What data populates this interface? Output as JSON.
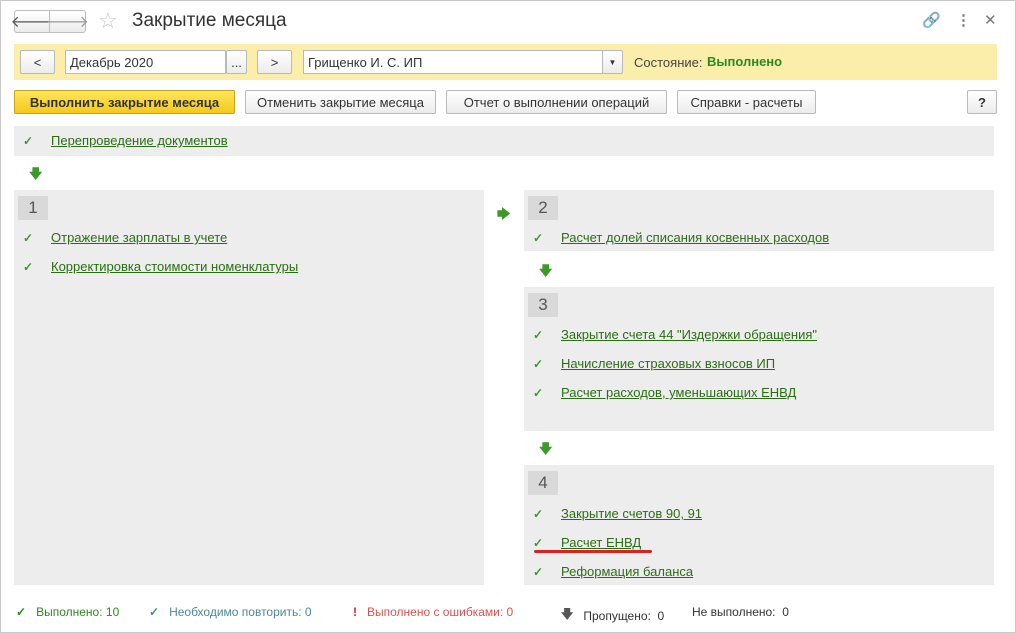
{
  "window": {
    "title": "Закрытие месяца",
    "back_icon": "arrow-left-icon",
    "forward_icon": "arrow-right-icon",
    "favorite_icon": "star-icon",
    "link_icon": "link-icon",
    "menu_icon": "more-vertical-icon",
    "close_icon": "close-icon"
  },
  "period": {
    "prev_label": "<",
    "next_label": ">",
    "month_value": "Декабрь 2020",
    "month_select_label": "...",
    "org_value": "Грищенко И. С. ИП",
    "status_label": "Состояние:",
    "status_value": "Выполнено"
  },
  "actions": {
    "run_label": "Выполнить закрытие месяца",
    "cancel_label": "Отменить закрытие месяца",
    "report_label": "Отчет о выполнении операций",
    "references_label": "Справки - расчеты",
    "help_label": "?"
  },
  "prestep": {
    "label": "Перепроведение документов"
  },
  "steps": [
    {
      "number": "1",
      "items": [
        {
          "label": "Отражение зарплаты в учете"
        },
        {
          "label": "Корректировка стоимости номенклатуры"
        }
      ]
    },
    {
      "number": "2",
      "items": [
        {
          "label": "Расчет долей списания косвенных расходов"
        }
      ]
    },
    {
      "number": "3",
      "items": [
        {
          "label": "Закрытие счета 44 \"Издержки обращения\""
        },
        {
          "label": "Начисление страховых взносов ИП"
        },
        {
          "label": "Расчет расходов, уменьшающих ЕНВД"
        }
      ]
    },
    {
      "number": "4",
      "items": [
        {
          "label": "Закрытие счетов 90, 91"
        },
        {
          "label": "Расчет ЕНВД"
        },
        {
          "label": "Реформация баланса"
        }
      ]
    }
  ],
  "legend": {
    "done_label": "Выполнено:",
    "done_count": "10",
    "repeat_label": "Необходимо повторить:",
    "repeat_count": "0",
    "errors_label": "Выполнено с ошибками:",
    "errors_count": "0",
    "skipped_label": "Пропущено:",
    "skipped_count": "0",
    "not_done_label": "Не выполнено:",
    "not_done_count": "0"
  },
  "colors": {
    "accent_green": "#2c8a1e",
    "toolbar_yellow": "#fbedaa",
    "error_red": "#e05050",
    "repeat_teal": "#4a8a9a"
  }
}
